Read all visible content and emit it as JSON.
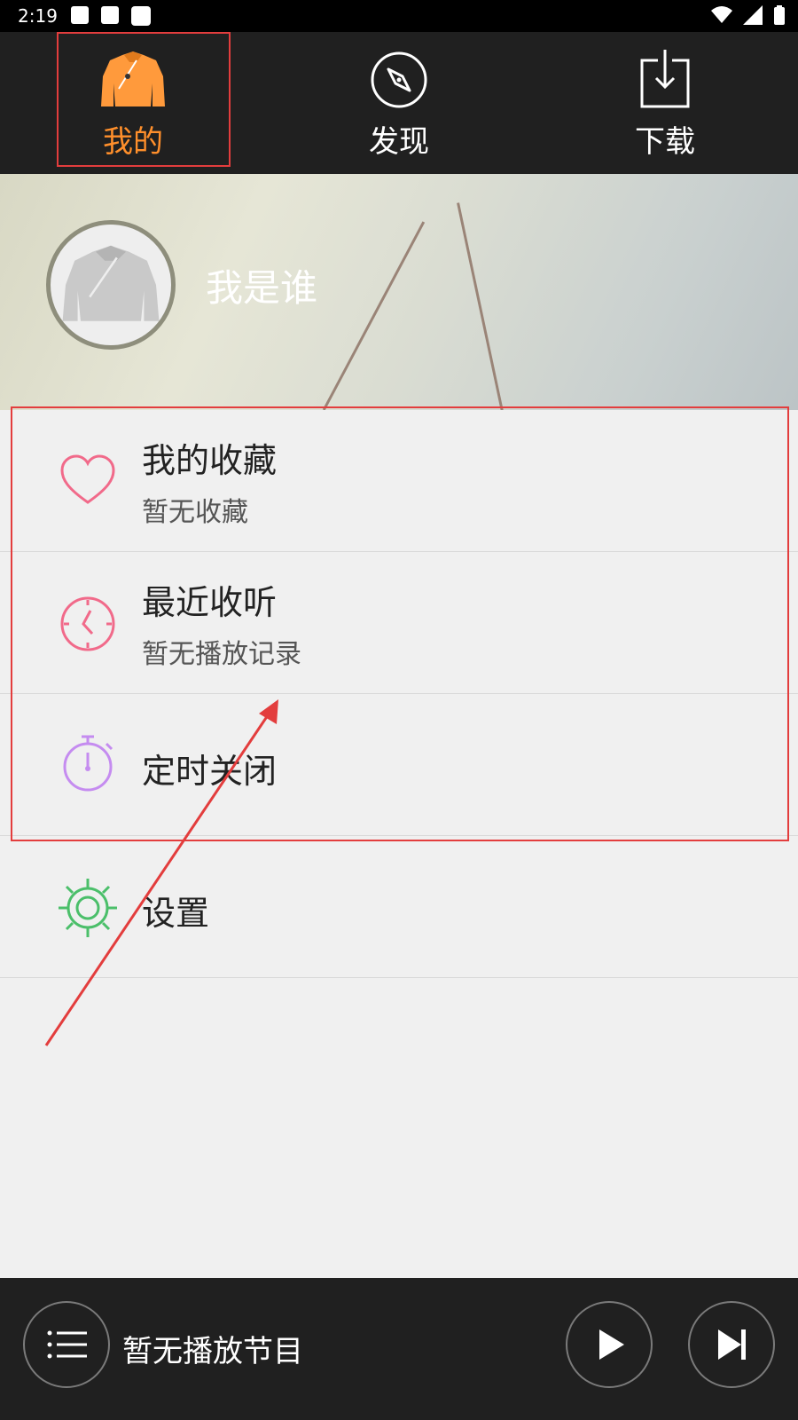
{
  "status_bar": {
    "time": "2:19"
  },
  "nav": {
    "tabs": [
      {
        "label": "我的",
        "icon": "jacket-icon",
        "active": true,
        "color": "#ff8f2b"
      },
      {
        "label": "发现",
        "icon": "compass-icon",
        "active": false
      },
      {
        "label": "下载",
        "icon": "download-icon",
        "active": false
      }
    ]
  },
  "profile": {
    "name": "我是谁",
    "avatar_icon": "jacket-icon"
  },
  "menu": {
    "items": [
      {
        "title": "我的收藏",
        "subtitle": "暂无收藏",
        "icon": "heart-icon",
        "icon_color": "#f16a8a"
      },
      {
        "title": "最近收听",
        "subtitle": "暂无播放记录",
        "icon": "clock-icon",
        "icon_color": "#f16a8a"
      },
      {
        "title": "定时关闭",
        "icon": "stopwatch-icon",
        "icon_color": "#c58cf0"
      },
      {
        "title": "设置",
        "icon": "settings-sun-icon",
        "icon_color": "#4bbf6a"
      }
    ]
  },
  "player": {
    "status_text": "暂无播放节目"
  },
  "annotation_color": "#e33d3d"
}
